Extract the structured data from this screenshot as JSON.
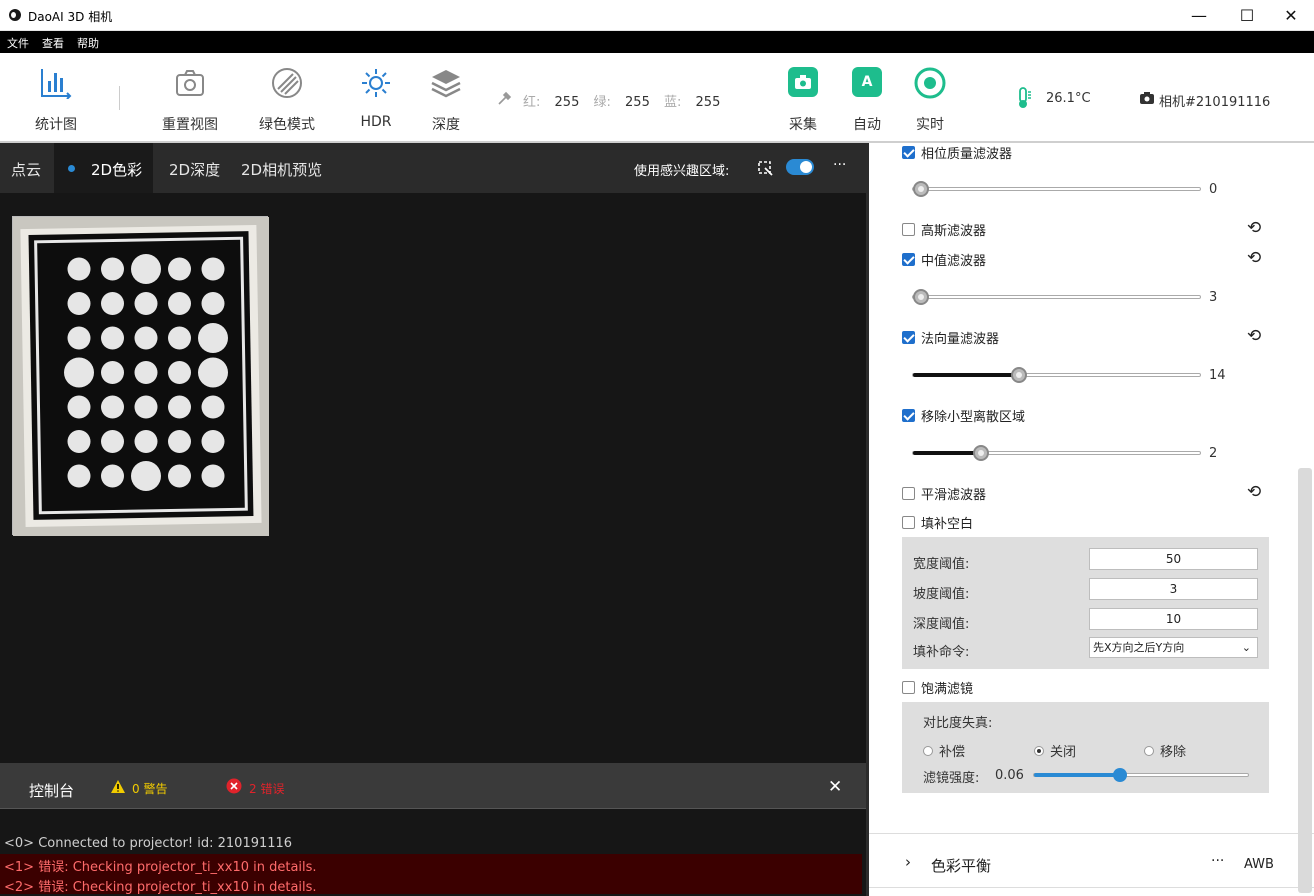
{
  "window": {
    "title": "DaoAI 3D 相机",
    "minimize": "—",
    "maximize": "☐",
    "close": "✕"
  },
  "menu": [
    "文件",
    "查看",
    "帮助"
  ],
  "toolbar": {
    "stats": "统计图",
    "reset_view": "重置视图",
    "green_mode": "绿色模式",
    "hdr": "HDR",
    "depth": "深度",
    "rgb": {
      "r_label": "红:",
      "r": "255",
      "g_label": "绿:",
      "g": "255",
      "b_label": "蓝:",
      "b": "255"
    },
    "capture": "采集",
    "auto": "自动",
    "auto_letter": "A",
    "live": "实时",
    "temperature": "26.1°C",
    "camera": "相机#210191116"
  },
  "tabs": {
    "point_cloud": "点云",
    "color2d": "2D色彩",
    "depth2d": "2D深度",
    "preview2d": "2D相机预览",
    "roi_label": "使用感兴趣区域:",
    "more": "···"
  },
  "console": {
    "title": "控制台",
    "warnings": "0 警告",
    "errors": "2 错误",
    "close": "✕",
    "lines": [
      "<0> Connected to projector! id: 210191116",
      "<1> 错误:  Checking projector_ti_xx10 in details.",
      "<2> 错误:  Checking projector_ti_xx10 in details."
    ]
  },
  "filters": {
    "phase_quality": {
      "label": "相位质量滤波器",
      "checked": true,
      "value": "0",
      "fraction": 0.0
    },
    "gaussian": {
      "label": "高斯滤波器",
      "checked": false
    },
    "median": {
      "label": "中值滤波器",
      "checked": true,
      "value": "3",
      "fraction": 0.0
    },
    "normal": {
      "label": "法向量滤波器",
      "checked": true,
      "value": "14",
      "fraction": 0.36
    },
    "remove_small": {
      "label": "移除小型离散区域",
      "checked": true,
      "value": "2",
      "fraction": 0.22
    },
    "smooth": {
      "label": "平滑滤波器",
      "checked": false
    },
    "fill_gaps": {
      "label": "填补空白",
      "checked": false
    },
    "width_thresh": {
      "label": "宽度阈值:",
      "value": "50"
    },
    "slope_thresh": {
      "label": "坡度阈值:",
      "value": "3"
    },
    "depth_thresh": {
      "label": "深度阈值:",
      "value": "10"
    },
    "fill_order": {
      "label": "填补命令:",
      "value": "先X方向之后Y方向"
    },
    "saturation": {
      "label": "饱满滤镜",
      "checked": false
    },
    "contrast_label": "对比度失真:",
    "contrast_options": [
      "补偿",
      "关闭",
      "移除"
    ],
    "contrast_selected": "关闭",
    "strength_label": "滤镜强度:",
    "strength_value": "0.06",
    "strength_fraction": 0.4
  },
  "color_balance": {
    "label": "色彩平衡",
    "more": "···",
    "awb": "AWB"
  }
}
